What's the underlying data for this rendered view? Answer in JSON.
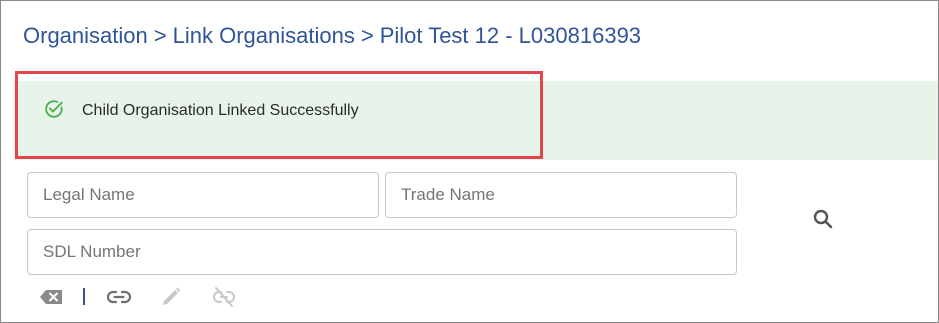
{
  "breadcrumb": {
    "items": [
      "Organisation",
      "Link Organisations",
      "Pilot Test 12 - L030816393"
    ],
    "separator": ">"
  },
  "alert": {
    "icon": "check-circle-icon",
    "message": "Child Organisation Linked Successfully",
    "background": "#e8f3ea",
    "icon_color": "#4caf50"
  },
  "highlight": {
    "color": "#e2454b"
  },
  "search": {
    "legal_name_placeholder": "Legal Name",
    "trade_name_placeholder": "Trade Name",
    "sdl_number_placeholder": "SDL Number",
    "search_icon": "search-icon"
  },
  "toolbar": {
    "items": [
      {
        "name": "clear-icon",
        "enabled": true
      },
      {
        "name": "link-icon",
        "enabled": true
      },
      {
        "name": "edit-icon",
        "enabled": false
      },
      {
        "name": "unlink-icon",
        "enabled": false
      }
    ]
  },
  "colors": {
    "accent": "#2f5597"
  }
}
